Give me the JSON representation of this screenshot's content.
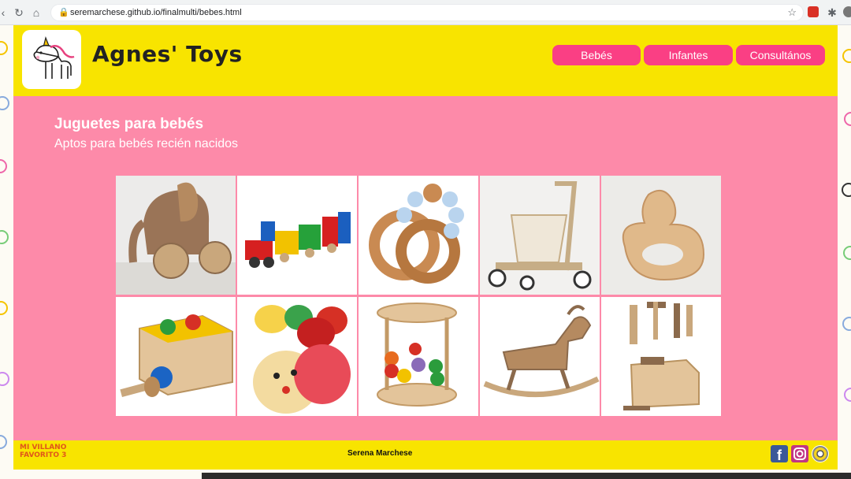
{
  "browser": {
    "url": "seremarchese.github.io/finalmulti/bebes.html"
  },
  "header": {
    "brand": "Agnes' Toys",
    "nav": [
      {
        "label": "Bebés"
      },
      {
        "label": "Infantes"
      },
      {
        "label": "Consultános"
      }
    ]
  },
  "main": {
    "title": "Juguetes para bebés",
    "subtitle": "Aptos para bebés recién nacidos",
    "products": [
      {
        "icon": "wooden-elephant-icon"
      },
      {
        "icon": "wooden-train-icon"
      },
      {
        "icon": "teething-rings-icon"
      },
      {
        "icon": "walker-cart-icon"
      },
      {
        "icon": "wooden-duck-icon"
      },
      {
        "icon": "pound-box-icon"
      },
      {
        "icon": "maracas-icon"
      },
      {
        "icon": "bead-rattle-icon"
      },
      {
        "icon": "rocking-horse-icon"
      },
      {
        "icon": "tool-set-icon"
      }
    ]
  },
  "footer": {
    "movie_logo": "MI VILLANO FAVORITO 3",
    "author": "Serena Marchese"
  },
  "colors": {
    "header_yellow": "#f8e400",
    "main_pink": "#fd8aa9",
    "button_pink": "#fa3f84"
  }
}
